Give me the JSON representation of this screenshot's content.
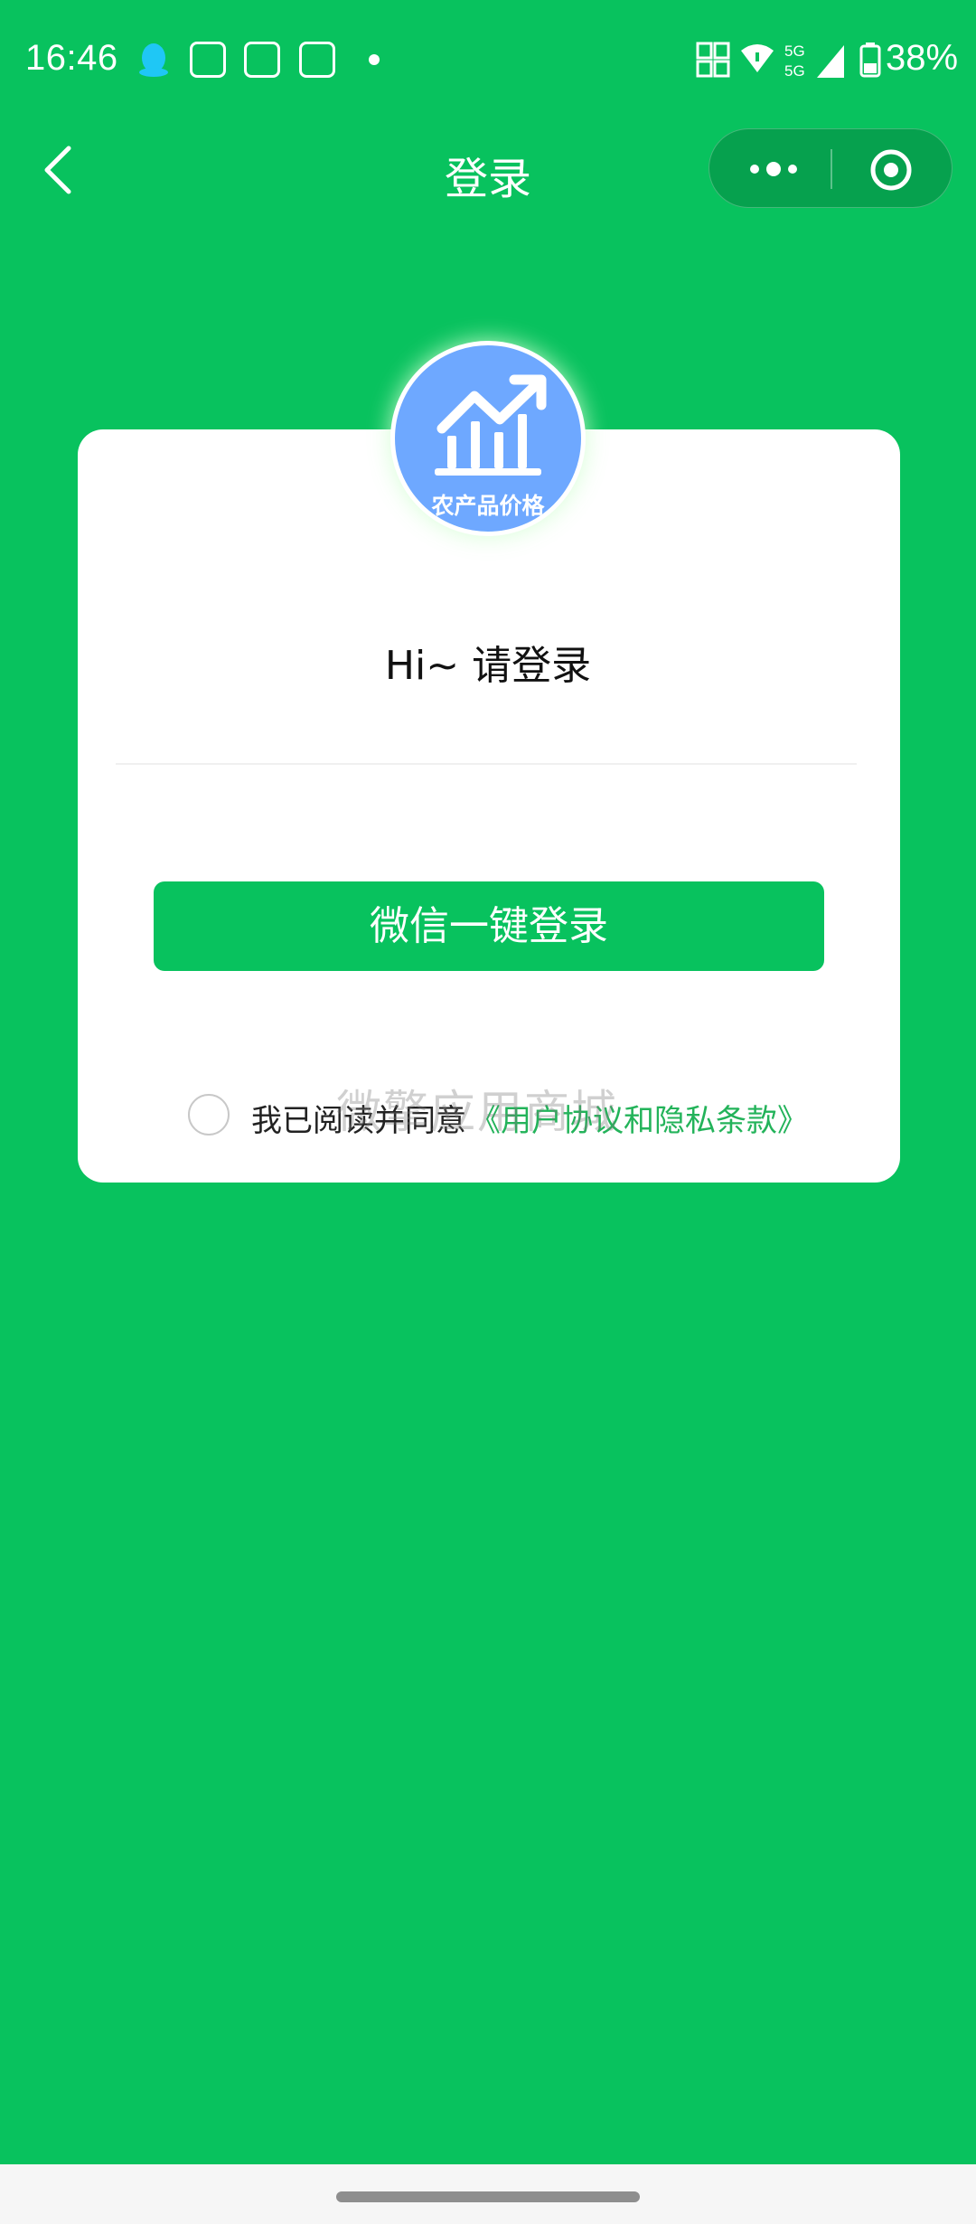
{
  "status_bar": {
    "time": "16:46",
    "battery": "38%",
    "signal_label": "5G",
    "icons": [
      "qq-icon",
      "baidu-paw-icon",
      "baidu-paw-icon",
      "baidu-paw-icon",
      "notification-dot-icon",
      "hd-icon",
      "wifi-icon",
      "signal-icon",
      "battery-icon"
    ]
  },
  "nav": {
    "title": "登录",
    "back_icon": "chevron-left-icon",
    "more_icon": "more-dots-icon",
    "close_icon": "target-close-icon"
  },
  "logo": {
    "text": "农产品价格",
    "icon": "trending-up-chart-icon"
  },
  "card": {
    "greeting": "Hi~ 请登录",
    "login_button": "微信一键登录",
    "agree_text": "我已阅读并同意",
    "agree_link": "《用户协议和隐私条款》",
    "watermark": "微擎应用商城"
  },
  "colors": {
    "background": "#08c25e",
    "button": "#08c25e",
    "link": "#23b35a",
    "logo": "#6ea8ff",
    "card": "#ffffff"
  }
}
